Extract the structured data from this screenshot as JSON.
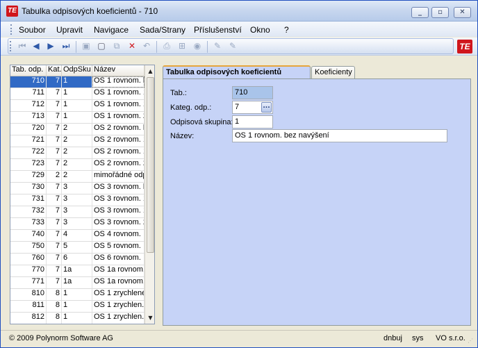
{
  "window": {
    "title": "Tabulka odpisových koeficientů - 710",
    "app_icon_text": "TE",
    "minimize": "_",
    "maximize": "▫",
    "close": "✕"
  },
  "menu": [
    "Soubor",
    "Upravit",
    "Navigace",
    "Sada/Strany",
    "Příslušenství",
    "Okno",
    "?"
  ],
  "toolbar": {
    "logo_text": "TE"
  },
  "list": {
    "headers": [
      "Tab. odp.",
      "Kat.",
      "OdpSku",
      "Název"
    ],
    "rows": [
      {
        "tab": "710",
        "kat": "7",
        "sk": "1",
        "nazev": "OS 1 rovnom. b"
      },
      {
        "tab": "711",
        "kat": "7",
        "sk": "1",
        "nazev": "OS 1 rovnom. 1"
      },
      {
        "tab": "712",
        "kat": "7",
        "sk": "1",
        "nazev": "OS 1 rovnom. 1"
      },
      {
        "tab": "713",
        "kat": "7",
        "sk": "1",
        "nazev": "OS 1 rovnom. 2"
      },
      {
        "tab": "720",
        "kat": "7",
        "sk": "2",
        "nazev": "OS 2 rovnom. b"
      },
      {
        "tab": "721",
        "kat": "7",
        "sk": "2",
        "nazev": "OS 2 rovnom. 1"
      },
      {
        "tab": "722",
        "kat": "7",
        "sk": "2",
        "nazev": "OS 2 rovnom. 1"
      },
      {
        "tab": "723",
        "kat": "7",
        "sk": "2",
        "nazev": "OS 2 rovnom. 2"
      },
      {
        "tab": "729",
        "kat": "2",
        "sk": "2",
        "nazev": "mimořádné odp"
      },
      {
        "tab": "730",
        "kat": "7",
        "sk": "3",
        "nazev": "OS 3 rovnom. b"
      },
      {
        "tab": "731",
        "kat": "7",
        "sk": "3",
        "nazev": "OS 3 rovnom. 1"
      },
      {
        "tab": "732",
        "kat": "7",
        "sk": "3",
        "nazev": "OS 3 rovnom. 1"
      },
      {
        "tab": "733",
        "kat": "7",
        "sk": "3",
        "nazev": "OS 3 rovnom. 2"
      },
      {
        "tab": "740",
        "kat": "7",
        "sk": "4",
        "nazev": "OS 4 rovnom."
      },
      {
        "tab": "750",
        "kat": "7",
        "sk": "5",
        "nazev": "OS 5 rovnom."
      },
      {
        "tab": "760",
        "kat": "7",
        "sk": "6",
        "nazev": "OS 6 rovnom."
      },
      {
        "tab": "770",
        "kat": "7",
        "sk": "1a",
        "nazev": "OS 1a rovnom."
      },
      {
        "tab": "771",
        "kat": "7",
        "sk": "1a",
        "nazev": "OS 1a rovnom."
      },
      {
        "tab": "810",
        "kat": "8",
        "sk": "1",
        "nazev": "OS 1 zrychlené"
      },
      {
        "tab": "811",
        "kat": "8",
        "sk": "1",
        "nazev": "OS 1 zrychlen."
      },
      {
        "tab": "812",
        "kat": "8",
        "sk": "1",
        "nazev": "OS 1 zrychlen."
      }
    ],
    "scroll_up": "▲",
    "scroll_down": "▼"
  },
  "tabs": [
    "Tabulka odpisových koeficientů",
    "Koeficienty"
  ],
  "form": {
    "tab_label": "Tab.:",
    "tab_value": "710",
    "kateg_label": "Kateg. odp.:",
    "kateg_value": "7",
    "lookup": "...",
    "skupina_label": "Odpisová skupina:",
    "skupina_value": "1",
    "nazev_label": "Název:",
    "nazev_value": "OS 1 rovnom. bez navýšení"
  },
  "status": {
    "copyright": "© 2009 Polynorm Software AG",
    "db": "dnbuj",
    "user": "sys",
    "company": "VO s.r.o."
  }
}
